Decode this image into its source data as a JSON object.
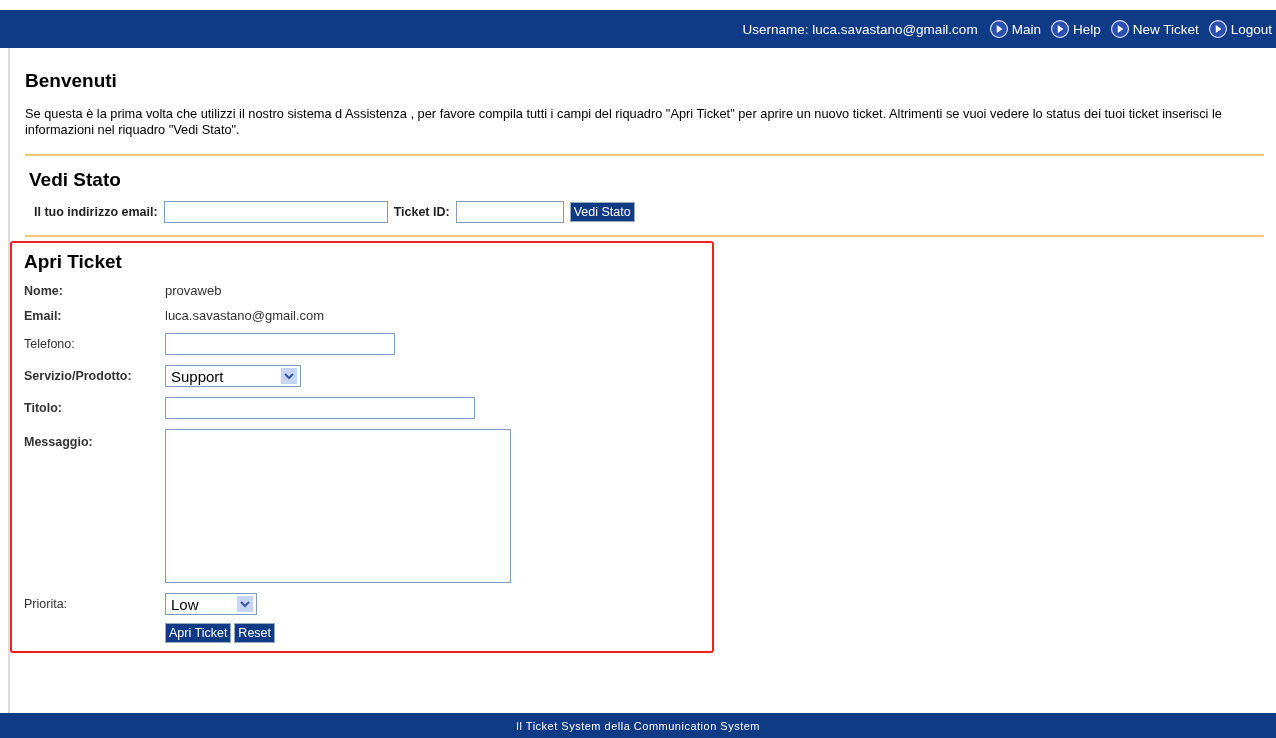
{
  "top_bar": {
    "username_label": "Username: luca.savastano@gmail.com",
    "links": [
      "Main",
      "Help",
      "New Ticket",
      "Logout"
    ]
  },
  "welcome": {
    "title": "Benvenuti",
    "text": "Se questa è la prima volta che utilizzi il nostro sistema d Assistenza , per favore compila tutti i campi del riquadro \"Apri Ticket\" per aprire un nuovo ticket. Altrimenti se vuoi vedere lo status dei tuoi ticket inserisci le informazioni nel riquadro \"Vedi Stato\"."
  },
  "status_check": {
    "title": "Vedi Stato",
    "email_label": "Il tuo indirizzo email:",
    "ticket_label": "Ticket ID:",
    "button": "Vedi Stato"
  },
  "open_ticket": {
    "title": "Apri Ticket",
    "highlighted": true,
    "fields": [
      {
        "kind": "text",
        "label": "Nome:",
        "required": true,
        "value": "provaweb"
      },
      {
        "kind": "text",
        "label": "Email:",
        "required": true,
        "value": "luca.savastano@gmail.com"
      },
      {
        "kind": "input",
        "label": "Telefono:",
        "required": false
      },
      {
        "kind": "select",
        "label": "Servizio/Prodotto:",
        "required": true,
        "value": "Support"
      },
      {
        "kind": "input",
        "label": "Titolo:",
        "required": true
      },
      {
        "kind": "textarea",
        "label": "Messaggio:",
        "required": true
      },
      {
        "kind": "select",
        "label": "Priorita:",
        "required": false,
        "value": "Low"
      }
    ],
    "buttons": [
      "Apri Ticket",
      "Reset"
    ]
  },
  "footer": "Il Ticket System della Communication System"
}
